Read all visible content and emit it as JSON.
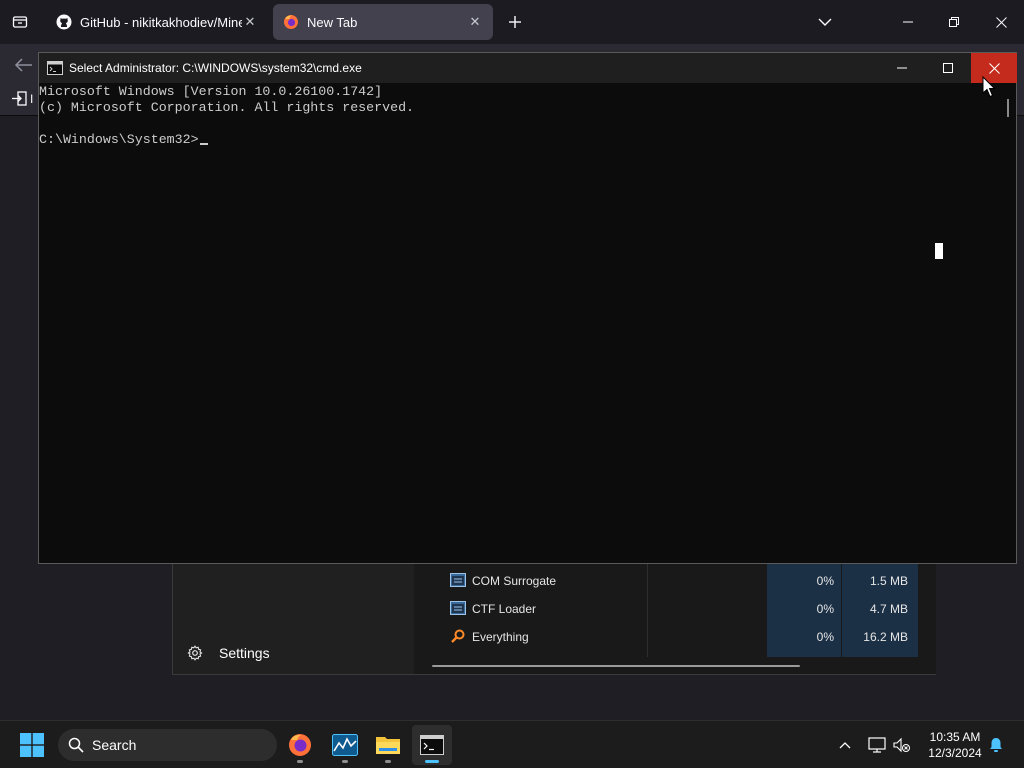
{
  "browser": {
    "tabs": [
      {
        "title": "GitHub - nikitkakhodiev/Minec",
        "favicon": "github-icon"
      },
      {
        "title": "New Tab",
        "favicon": "firefox-icon",
        "active": true
      }
    ],
    "bookmarks_import_label": "I"
  },
  "cmd": {
    "title": "Select Administrator: C:\\WINDOWS\\system32\\cmd.exe",
    "lines": [
      "Microsoft Windows [Version 10.0.26100.1742]",
      "(c) Microsoft Corporation. All rights reserved.",
      "",
      "C:\\Windows\\System32>"
    ]
  },
  "task_manager": {
    "settings_label": "Settings",
    "processes": [
      {
        "name": "COM Surrogate",
        "cpu": "0%",
        "memory": "1.5 MB",
        "icon": "app-window-icon"
      },
      {
        "name": "CTF Loader",
        "cpu": "0%",
        "memory": "4.7 MB",
        "icon": "app-window-icon"
      },
      {
        "name": "Everything",
        "cpu": "0%",
        "memory": "16.2 MB",
        "icon": "search-magnifier-icon"
      }
    ]
  },
  "taskbar": {
    "search_label": "Search",
    "apps": [
      "firefox-icon",
      "task-manager-icon",
      "file-explorer-icon",
      "terminal-icon"
    ],
    "clock_time": "10:35 AM",
    "clock_date": "12/3/2024"
  },
  "colors": {
    "close_red": "#c42b1c",
    "accent_blue": "#4cc2ff",
    "tm_highlight": "#1b2f45"
  }
}
